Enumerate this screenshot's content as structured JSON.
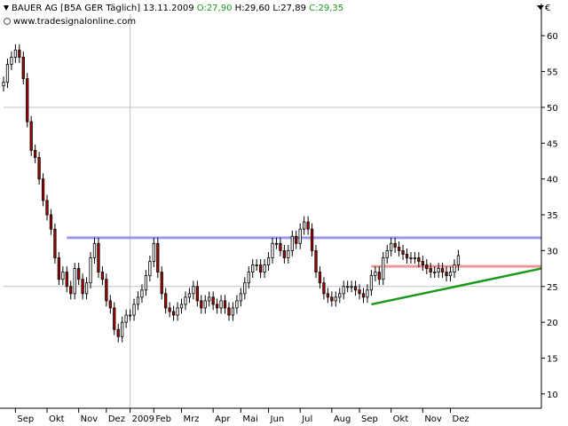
{
  "header": {
    "title": "BAUER AG [B5A GER  Täglich]",
    "date": "13.11.2009",
    "open": "O:27,90",
    "high": "H:29,60",
    "low": "L:27,89",
    "close": "C:29,35",
    "website": "www.tradesignalonline.com",
    "currency": "€"
  },
  "colors": {
    "up_candle": "#ffffff",
    "down_candle": "#b00000",
    "resistance_line": "#9999ee",
    "support_line": "#ee9999",
    "trend_line": "#1a9a1a",
    "grid": "#b8c8b8"
  },
  "chart_data": {
    "type": "line",
    "title": "BAUER AG [B5A GER  Täglich]",
    "xlabel": "",
    "ylabel": "",
    "ylim": [
      8,
      63
    ],
    "y_ticks": [
      10,
      15,
      20,
      25,
      30,
      35,
      40,
      45,
      50,
      55,
      60
    ],
    "x_ticks": [
      "Sep",
      "Okt",
      "Nov",
      "Dez",
      "2009",
      "Feb",
      "Mrz",
      "Apr",
      "Mai",
      "Jun",
      "Jul",
      "Aug",
      "Sep",
      "Okt",
      "Nov",
      "Dez"
    ],
    "grid": "sparse",
    "price": [
      [
        0,
        53.5
      ],
      [
        1,
        56
      ],
      [
        2,
        57
      ],
      [
        3,
        58
      ],
      [
        4,
        57
      ],
      [
        5,
        54
      ],
      [
        6,
        48
      ],
      [
        7,
        44
      ],
      [
        8,
        43
      ],
      [
        9,
        40
      ],
      [
        10,
        37
      ],
      [
        11,
        35
      ],
      [
        12,
        33
      ],
      [
        13,
        29
      ],
      [
        14,
        26
      ],
      [
        15,
        27
      ],
      [
        16,
        25
      ],
      [
        17,
        24
      ],
      [
        18,
        27.5
      ],
      [
        19,
        26
      ],
      [
        20,
        24
      ],
      [
        21,
        25.5
      ],
      [
        22,
        29
      ],
      [
        23,
        31
      ],
      [
        24,
        27
      ],
      [
        25,
        26
      ],
      [
        26,
        23
      ],
      [
        27,
        22
      ],
      [
        28,
        19
      ],
      [
        29,
        18
      ],
      [
        30,
        20
      ],
      [
        31,
        21
      ],
      [
        32,
        21
      ],
      [
        33,
        22.5
      ],
      [
        34,
        23.5
      ],
      [
        35,
        24.5
      ],
      [
        36,
        26.5
      ],
      [
        37,
        28.5
      ],
      [
        38,
        31
      ],
      [
        39,
        27
      ],
      [
        40,
        24
      ],
      [
        41,
        22
      ],
      [
        42,
        21.5
      ],
      [
        43,
        21
      ],
      [
        44,
        22
      ],
      [
        45,
        22.5
      ],
      [
        46,
        23.5
      ],
      [
        47,
        24
      ],
      [
        48,
        25
      ],
      [
        49,
        23
      ],
      [
        50,
        22
      ],
      [
        51,
        23
      ],
      [
        52,
        23.5
      ],
      [
        53,
        22.5
      ],
      [
        54,
        22
      ],
      [
        55,
        23
      ],
      [
        56,
        22
      ],
      [
        57,
        21
      ],
      [
        58,
        22
      ],
      [
        59,
        23
      ],
      [
        60,
        24
      ],
      [
        61,
        25.5
      ],
      [
        62,
        27
      ],
      [
        63,
        28
      ],
      [
        64,
        28
      ],
      [
        65,
        27
      ],
      [
        66,
        28
      ],
      [
        67,
        29
      ],
      [
        68,
        31
      ],
      [
        69,
        31
      ],
      [
        70,
        30
      ],
      [
        71,
        29
      ],
      [
        72,
        30
      ],
      [
        73,
        32
      ],
      [
        74,
        31
      ],
      [
        75,
        33
      ],
      [
        76,
        34
      ],
      [
        77,
        33
      ],
      [
        78,
        30
      ],
      [
        79,
        27
      ],
      [
        80,
        25.5
      ],
      [
        81,
        24
      ],
      [
        82,
        23.5
      ],
      [
        83,
        23
      ],
      [
        84,
        23.5
      ],
      [
        85,
        24
      ],
      [
        86,
        25
      ],
      [
        87,
        25
      ],
      [
        88,
        25
      ],
      [
        89,
        24.5
      ],
      [
        90,
        24
      ],
      [
        91,
        23.5
      ],
      [
        92,
        24.5
      ],
      [
        93,
        26.5
      ],
      [
        94,
        27
      ],
      [
        95,
        26
      ],
      [
        96,
        29
      ],
      [
        97,
        30
      ],
      [
        98,
        31
      ],
      [
        99,
        30.5
      ],
      [
        100,
        30
      ],
      [
        101,
        29.5
      ],
      [
        102,
        29
      ],
      [
        103,
        29
      ],
      [
        104,
        29
      ],
      [
        105,
        28.5
      ],
      [
        106,
        28
      ],
      [
        107,
        27.5
      ],
      [
        108,
        27
      ],
      [
        109,
        27
      ],
      [
        110,
        27.5
      ],
      [
        111,
        27
      ],
      [
        112,
        26.5
      ],
      [
        113,
        27
      ],
      [
        114,
        28
      ],
      [
        115,
        29.3
      ]
    ],
    "x_range": [
      0,
      136
    ],
    "x_tick_pos": [
      3,
      11,
      19,
      26,
      32,
      38,
      45,
      53,
      60,
      67,
      75,
      83,
      90,
      98,
      106,
      113
    ],
    "hlines": [
      {
        "y": 31.8,
        "from": 16,
        "to": 136,
        "role": "resistance"
      },
      {
        "y": 27.8,
        "from": 93,
        "to": 136,
        "role": "support"
      }
    ],
    "trendline": {
      "from": [
        93,
        22.5
      ],
      "to": [
        136,
        27.5
      ]
    }
  }
}
